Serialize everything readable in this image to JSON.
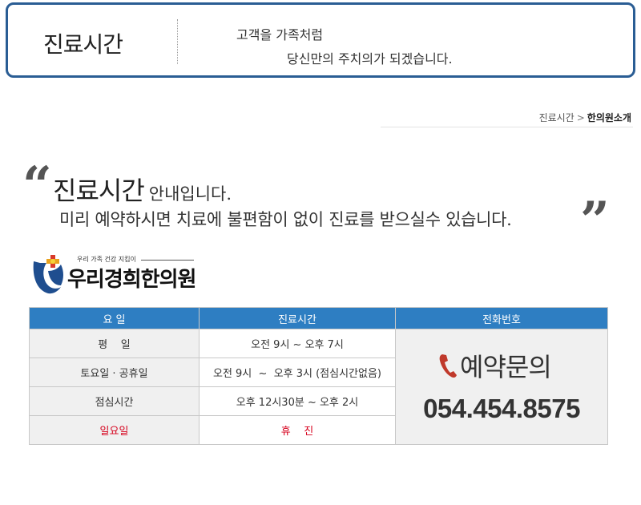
{
  "header": {
    "title": "진료시간",
    "slogan_line1": "고객을 가족처럼",
    "slogan_line2": "당신만의 주치의가 되겠습니다."
  },
  "breadcrumb": {
    "parent": "진료시간",
    "separator": ">",
    "current": "한의원소개"
  },
  "intro": {
    "open_quote": "“",
    "close_quote": "”",
    "headline_strong": "진료시간",
    "headline_rest": "안내입니다.",
    "subline": "미리 예약하시면 치료에 불편함이 없이 진료를 받으실수 있습니다."
  },
  "logo": {
    "tagline": "우리 가족 건강 지킴이",
    "name": "우리경희한의원"
  },
  "table": {
    "headers": [
      "요 일",
      "진료시간",
      "전화번호"
    ],
    "rows": [
      {
        "day": "평    일",
        "hours": "오전 9시 ~  오후 7시"
      },
      {
        "day": "토요일 · 공휴일",
        "hours": "오전 9시  ~  오후 3시 (점심시간없음)"
      },
      {
        "day": "점심시간",
        "hours": "오후 12시30분 ~ 오후 2시"
      },
      {
        "day": "일요일",
        "hours": "휴    진"
      }
    ],
    "booking_label": "예약문의",
    "phone": "054.454.8575"
  },
  "colors": {
    "accent": "#2e7ec2",
    "header_border": "#2a5d94",
    "holiday_red": "#d6001c"
  }
}
